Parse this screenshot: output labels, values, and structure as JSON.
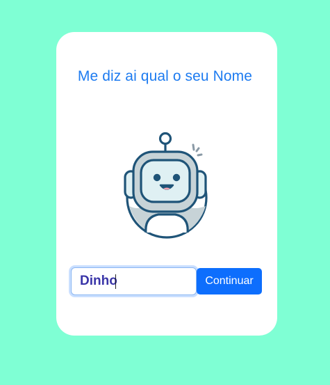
{
  "page": {
    "background": "#7fffd4",
    "card_background": "#ffffff",
    "accent": "#0d6efd"
  },
  "prompt": {
    "title": "Me diz ai qual o seu Nome"
  },
  "illustration": {
    "icon": "robot-icon",
    "colors": {
      "outline": "#1f5478",
      "face": "#dff0f3",
      "body": "#c7d3d7",
      "tongue": "#f4a3b1"
    }
  },
  "form": {
    "name_value": "Dinho",
    "continue_label": "Continuar"
  }
}
